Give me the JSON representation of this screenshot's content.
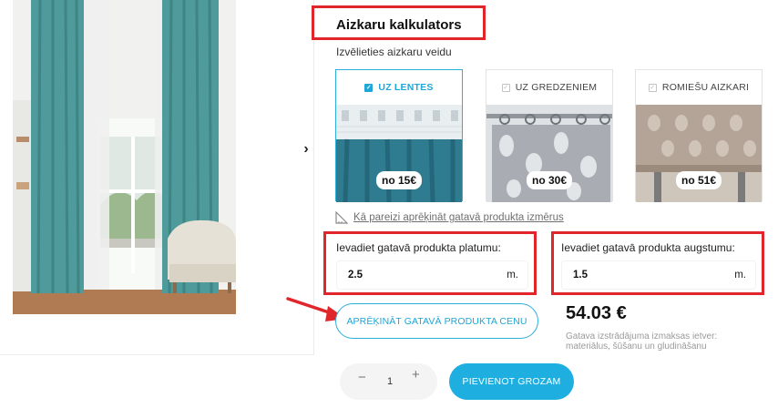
{
  "gallery": {
    "next_icon": "chevron-right-icon"
  },
  "calculator": {
    "title": "Aizkaru kalkulators",
    "subtitle": "Izvēlieties aizkaru veidu",
    "types": [
      {
        "label": "UZ LENTES",
        "price": "no 15€",
        "selected": true
      },
      {
        "label": "UZ GREDZENIEM",
        "price": "no 30€",
        "selected": false
      },
      {
        "label": "ROMIEŠU AIZKARI",
        "price": "no 51€",
        "selected": false
      }
    ],
    "howto_link": "Kā pareizi aprēķināt gatavā produkta izmērus",
    "width": {
      "label": "Ievadiet gatavā produkta platumu:",
      "value": "2.5",
      "unit": "m."
    },
    "height": {
      "label": "Ievadiet gatavā produkta augstumu:",
      "value": "1.5",
      "unit": "m."
    },
    "calc_button": "APRĒĶINĀT GATAVĀ PRODUKTA CENU",
    "total": "54.03 €",
    "note": "Gatava izstrādājuma izmaksas ietver: materiālus, šūšanu un gludināšanu"
  },
  "cart": {
    "minus": "−",
    "quantity": "1",
    "plus": "+",
    "add_button": "PIEVIENOT GROZAM"
  },
  "colors": {
    "accent": "#1ea6d6",
    "highlight": "#e0262b",
    "curtain_teal": "#4f9a9a"
  }
}
